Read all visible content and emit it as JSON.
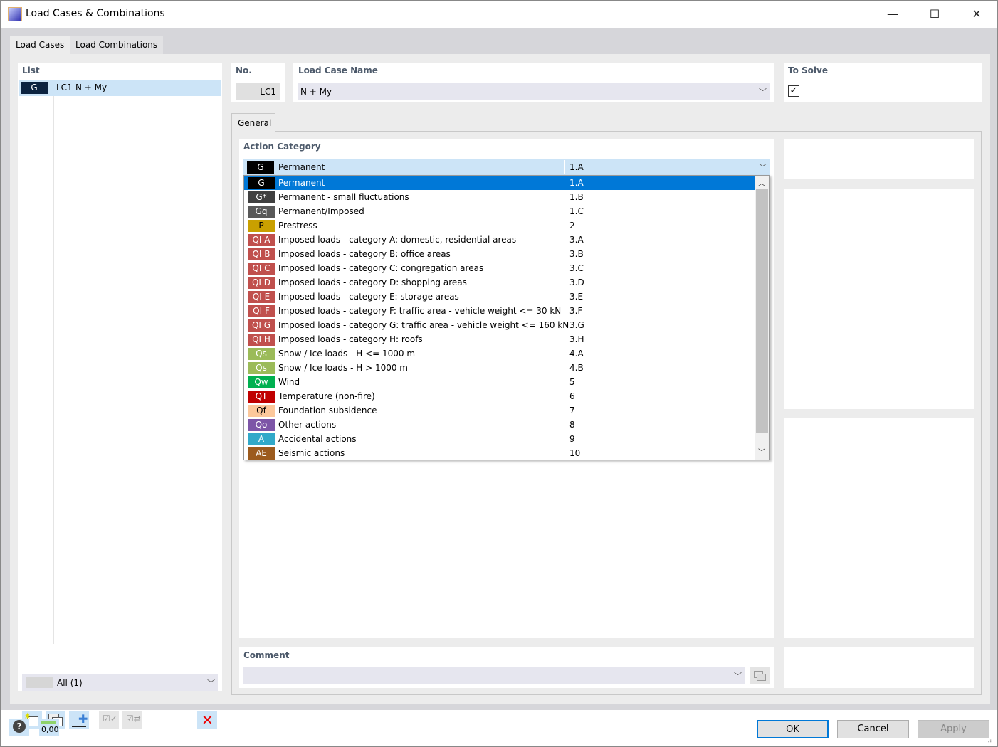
{
  "window": {
    "title": "Load Cases & Combinations"
  },
  "tabs": [
    {
      "label": "Load Cases",
      "active": true
    },
    {
      "label": "Load Combinations",
      "active": false
    }
  ],
  "list": {
    "header": "List",
    "items": [
      {
        "badge": "G",
        "badge_color": "#0c2340",
        "id": "LC1",
        "name": "N + My",
        "selected": true
      }
    ],
    "filter": {
      "value": "All (1)"
    }
  },
  "no": {
    "label": "No.",
    "value": "LC1"
  },
  "name": {
    "label": "Load Case Name",
    "value": "N + My"
  },
  "to_solve": {
    "label": "To Solve",
    "checked": true
  },
  "subtabs": [
    {
      "label": "General"
    }
  ],
  "action_category": {
    "label": "Action Category",
    "selected": {
      "badge": "G",
      "label": "Permanent",
      "code": "1.A"
    },
    "options": [
      {
        "badge": "G",
        "color": "#000000",
        "label": "Permanent",
        "code": "1.A",
        "selected": true
      },
      {
        "badge": "G*",
        "color": "#404040",
        "label": "Permanent - small fluctuations",
        "code": "1.B"
      },
      {
        "badge": "Gq",
        "color": "#595959",
        "label": "Permanent/Imposed",
        "code": "1.C"
      },
      {
        "badge": "P",
        "color": "#c9a000",
        "label": "Prestress",
        "code": "2"
      },
      {
        "badge": "QI A",
        "color": "#c0504d",
        "label": "Imposed loads - category A: domestic, residential areas",
        "code": "3.A"
      },
      {
        "badge": "QI B",
        "color": "#c0504d",
        "label": "Imposed loads - category B: office areas",
        "code": "3.B"
      },
      {
        "badge": "QI C",
        "color": "#c0504d",
        "label": "Imposed loads - category C: congregation areas",
        "code": "3.C"
      },
      {
        "badge": "QI D",
        "color": "#c0504d",
        "label": "Imposed loads - category D: shopping areas",
        "code": "3.D"
      },
      {
        "badge": "QI E",
        "color": "#c0504d",
        "label": "Imposed loads - category E: storage areas",
        "code": "3.E"
      },
      {
        "badge": "QI F",
        "color": "#c0504d",
        "label": "Imposed loads - category F: traffic area - vehicle weight <= 30 kN",
        "code": "3.F"
      },
      {
        "badge": "QI G",
        "color": "#c0504d",
        "label": "Imposed loads - category G: traffic area - vehicle weight <= 160 kN",
        "code": "3.G"
      },
      {
        "badge": "QI H",
        "color": "#c0504d",
        "label": "Imposed loads - category H: roofs",
        "code": "3.H"
      },
      {
        "badge": "Qs",
        "color": "#9bbb59",
        "label": "Snow / Ice loads - H <= 1000 m",
        "code": "4.A"
      },
      {
        "badge": "Qs",
        "color": "#9bbb59",
        "label": "Snow / Ice loads - H > 1000 m",
        "code": "4.B"
      },
      {
        "badge": "Qw",
        "color": "#00b050",
        "label": "Wind",
        "code": "5"
      },
      {
        "badge": "QT",
        "color": "#c00000",
        "label": "Temperature (non-fire)",
        "code": "6"
      },
      {
        "badge": "Qf",
        "color": "#fcc89b",
        "label": "Foundation subsidence",
        "code": "7"
      },
      {
        "badge": "Qo",
        "color": "#7d55a7",
        "label": "Other actions",
        "code": "8"
      },
      {
        "badge": "A",
        "color": "#31a9c9",
        "label": "Accidental actions",
        "code": "9"
      },
      {
        "badge": "AE",
        "color": "#9c5b1e",
        "label": "Seismic actions",
        "code": "10"
      }
    ]
  },
  "comment": {
    "label": "Comment",
    "value": ""
  },
  "buttons": {
    "ok": "OK",
    "cancel": "Cancel",
    "apply": "Apply"
  },
  "status_icons": {
    "units": "0,00"
  }
}
